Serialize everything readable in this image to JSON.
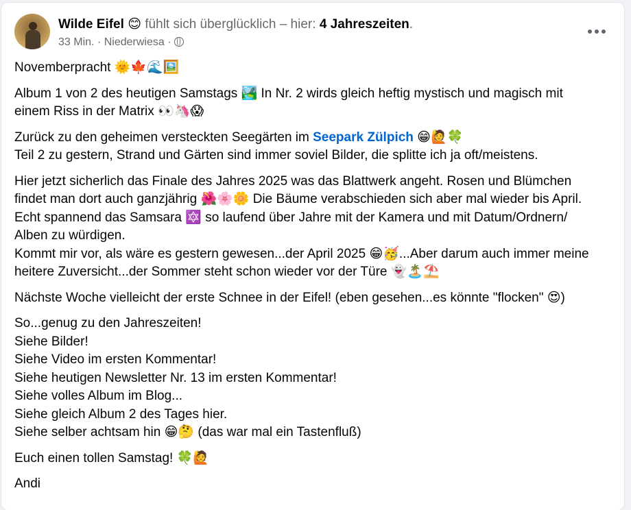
{
  "post": {
    "author": "Wilde Eifel",
    "author_emoji": "😊",
    "feeling_text": "fühlt sich überglücklich – hier:",
    "place": "4 Jahreszeiten",
    "place_suffix": ".",
    "time": "33 Min.",
    "separator": "·",
    "location": "Niederwiesa",
    "privacy_icon": "globe-icon",
    "more_icon": "more-horizontal-icon",
    "paragraphs": {
      "p1": {
        "text": "Novemberpracht 🌞🍁🌊🖼️"
      },
      "p2": {
        "line1": "Album 1 von 2 des heutigen Samstags 🏞️ In Nr. 2 wirds gleich heftig mystisch und magisch mit",
        "line2": "einem Riss in der Matrix 👀🦄😱"
      },
      "p3": {
        "line1_before": "Zurück zu den geheimen versteckten Seegärten im ",
        "link": "Seepark Zülpich",
        "line1_after": " 😁🙋🍀",
        "line2": "Teil 2 zu gestern, Strand und Gärten sind immer soviel Bilder, die splitte ich ja oft/meistens."
      },
      "p4": {
        "lines": [
          "Hier jetzt sicherlich das Finale des Jahres 2025 was das Blattwerk angeht. Rosen und Blümchen",
          "findet man dort auch ganzjährig 🌺🌸🌼 Die Bäume verabschieden sich aber mal wieder bis April.",
          "Echt spannend das Samsara 🔯 so laufend über Jahre mit der Kamera und mit Datum/Ordnern/",
          "Alben zu würdigen.",
          "Kommt mir vor, als wäre es gestern gewesen...der April 2025 😁🥳...Aber darum auch immer meine",
          "heitere Zuversicht...der Sommer steht schon wieder vor der Türe 👻🏝️⛱️"
        ]
      },
      "p5": {
        "text": "Nächste Woche vielleicht der erste Schnee in der Eifel! (eben gesehen...es könnte \"flocken\" 😍)"
      },
      "p6": {
        "lines": [
          "So...genug zu den Jahreszeiten!",
          "Siehe Bilder!",
          "Siehe Video im ersten Kommentar!",
          "Siehe heutigen Newsletter Nr. 13 im ersten Kommentar!",
          "Siehe volles Album im Blog...",
          "Siehe gleich Album 2 des Tages hier.",
          "Siehe selber achtsam hin 😁🤔 (das war mal ein Tastenfluß)"
        ]
      },
      "p7": {
        "text": "Euch einen tollen Samstag! 🍀🙋"
      },
      "p8": {
        "text": "Andi"
      }
    }
  }
}
